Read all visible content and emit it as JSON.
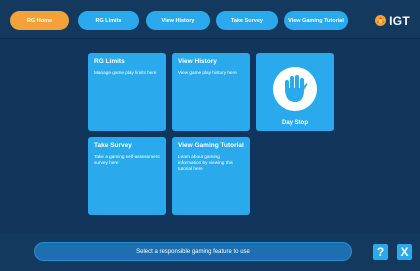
{
  "nav": {
    "tabs": [
      {
        "label": "RG Home",
        "active": true
      },
      {
        "label": "RG Limits",
        "active": false
      },
      {
        "label": "View History",
        "active": false
      },
      {
        "label": "Take Survey",
        "active": false
      },
      {
        "label": "View Gaming Tutorial",
        "active": false
      }
    ],
    "logo_text": "IGT"
  },
  "tiles": [
    {
      "title": "RG Limits",
      "desc": "Manage game play limits here"
    },
    {
      "title": "View History",
      "desc": "View game play history here"
    },
    {
      "title": "Take Survey",
      "desc": "Take a gaming self-assessment survey here"
    },
    {
      "title": "View Gaming Tutorial",
      "desc": "Learn about gaming information by viewing this tutorial here"
    }
  ],
  "daystop": {
    "label": "Day Stop",
    "icon": "hand-stop-icon"
  },
  "status": {
    "text": "Select a responsible gaming feature to use"
  },
  "buttons": {
    "help": "?",
    "close": "X"
  },
  "colors": {
    "accent": "#2aa9ec",
    "active": "#f5a13a",
    "background": "#12355b"
  }
}
